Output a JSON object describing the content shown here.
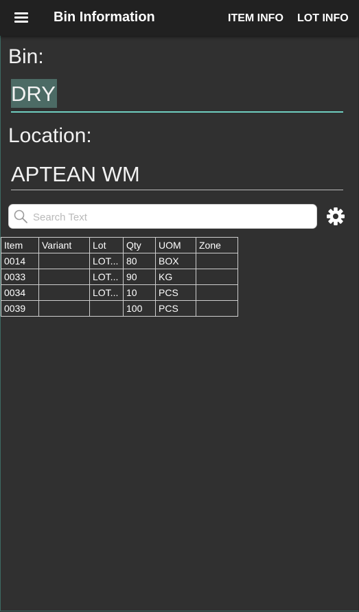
{
  "appbar": {
    "title": "Bin Information",
    "actions": [
      "ITEM INFO",
      "LOT INFO"
    ]
  },
  "bin": {
    "label": "Bin:",
    "value": "DRY"
  },
  "location": {
    "label": "Location:",
    "value": "APTEAN WM"
  },
  "search": {
    "placeholder": "Search Text",
    "value": ""
  },
  "table": {
    "columns": [
      "Item",
      "Variant",
      "Lot",
      "Qty",
      "UOM",
      "Zone"
    ],
    "rows": [
      [
        "0014",
        "",
        "LOT...",
        "80",
        "BOX",
        ""
      ],
      [
        "0033",
        "",
        "LOT...",
        "90",
        "KG",
        ""
      ],
      [
        "0034",
        "",
        "LOT...",
        "10",
        "PCS",
        ""
      ],
      [
        "0039",
        "",
        "",
        "100",
        "PCS",
        ""
      ]
    ]
  },
  "colors": {
    "background": "#303030",
    "appbar": "#212121",
    "accent": "#6fcfc0"
  }
}
